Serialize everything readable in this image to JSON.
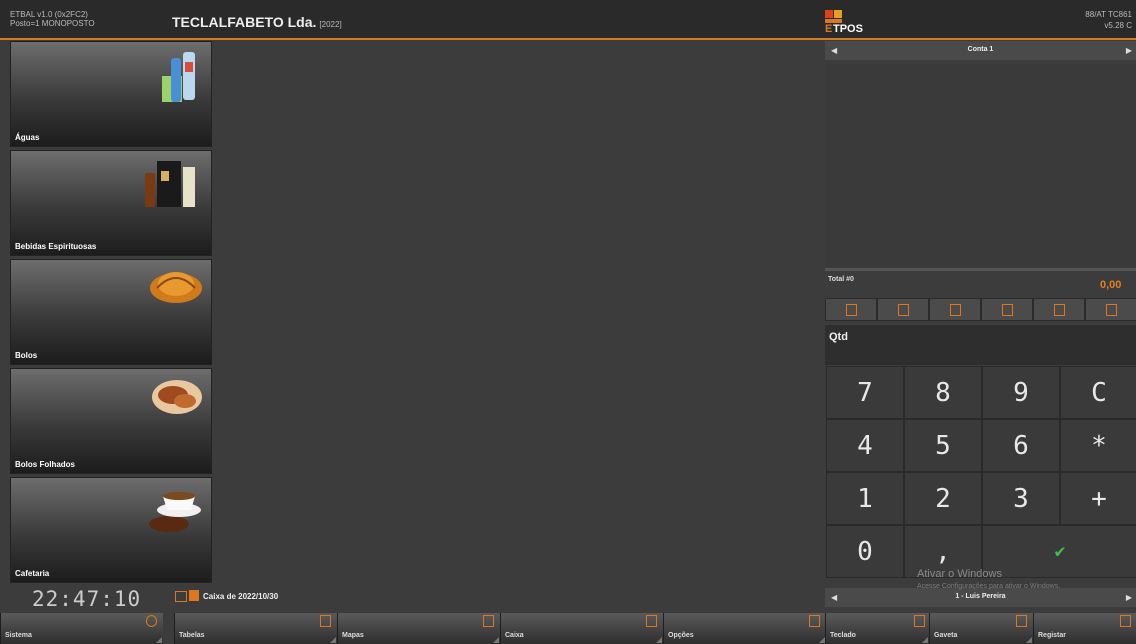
{
  "header": {
    "app_version": "ETBAL v1.0 (0x2FC2)",
    "post_info": "Posto=1 MONOPOSTO",
    "company": "TECLALFABETO Lda.",
    "company_year": "[2022]",
    "logo_text": "ETPOS",
    "cert": "88/AT TC861",
    "version": "v5.28 C"
  },
  "categories": [
    {
      "label": "Águas",
      "icon": "water-bottles-image"
    },
    {
      "label": "Bebidas Espirituosas",
      "icon": "liquor-bottles-image"
    },
    {
      "label": "Bolos",
      "icon": "croissant-image"
    },
    {
      "label": "Bolos Folhados",
      "icon": "pastry-image"
    },
    {
      "label": "Cafetaria",
      "icon": "coffee-cup-image"
    }
  ],
  "status": {
    "clock": "22:47:10",
    "caixa": "Caixa de 2022/10/30"
  },
  "nav": [
    {
      "label": "Sistema",
      "icon": "gear-icon"
    },
    {
      "label": "Tabelas",
      "icon": "tables-icon"
    },
    {
      "label": "Mapas",
      "icon": "maps-icon"
    },
    {
      "label": "Caixa",
      "icon": "cash-icon"
    },
    {
      "label": "Opções",
      "icon": "grid-icon"
    },
    {
      "label": "Teclado",
      "icon": "keyboard-icon"
    },
    {
      "label": "Gaveta",
      "icon": "drawer-icon"
    },
    {
      "label": "Registar",
      "icon": "register-icon"
    }
  ],
  "order": {
    "conta": "Conta 1",
    "total_label": "Total #0",
    "total_value": "0,00",
    "qtd_label": "Qtd",
    "user": "1 - Luis Pereira"
  },
  "keypad": [
    "7",
    "8",
    "9",
    "C",
    "4",
    "5",
    "6",
    "*",
    "1",
    "2",
    "3",
    "+",
    "0",
    ",",
    "✔"
  ],
  "watermark": {
    "title": "Ativar o Windows",
    "text": "Acesse Configurações para ativar o Windows."
  },
  "colors": {
    "accent": "#d9781e",
    "confirm": "#3cc04a"
  }
}
